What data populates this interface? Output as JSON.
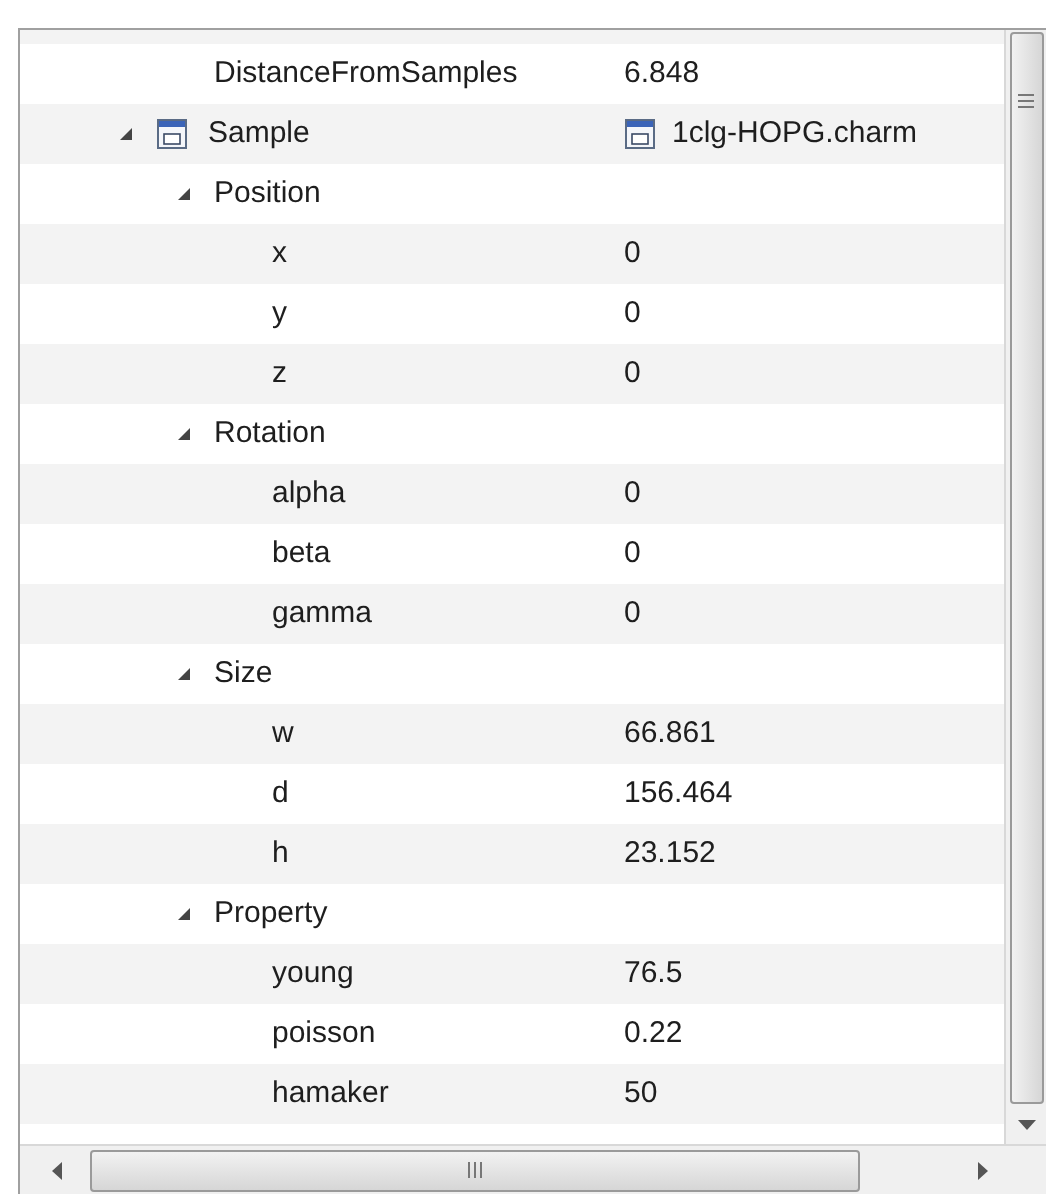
{
  "tree": [
    {
      "name": "DistanceFromSamples",
      "value": "6.848"
    },
    {
      "name": "Sample",
      "value": "1clg-HOPG.charm",
      "kind": "object",
      "expanded": true,
      "children": [
        {
          "name": "Position",
          "expanded": true,
          "children": [
            {
              "name": "x",
              "value": "0"
            },
            {
              "name": "y",
              "value": "0"
            },
            {
              "name": "z",
              "value": "0"
            }
          ]
        },
        {
          "name": "Rotation",
          "expanded": true,
          "children": [
            {
              "name": "alpha",
              "value": "0"
            },
            {
              "name": "beta",
              "value": "0"
            },
            {
              "name": "gamma",
              "value": "0"
            }
          ]
        },
        {
          "name": "Size",
          "expanded": true,
          "children": [
            {
              "name": "w",
              "value": "66.861"
            },
            {
              "name": "d",
              "value": "156.464"
            },
            {
              "name": "h",
              "value": "23.152"
            }
          ]
        },
        {
          "name": "Property",
          "expanded": true,
          "children": [
            {
              "name": "young",
              "value": "76.5"
            },
            {
              "name": "poisson",
              "value": "0.22"
            },
            {
              "name": "hamaker",
              "value": "50"
            }
          ]
        }
      ]
    }
  ]
}
